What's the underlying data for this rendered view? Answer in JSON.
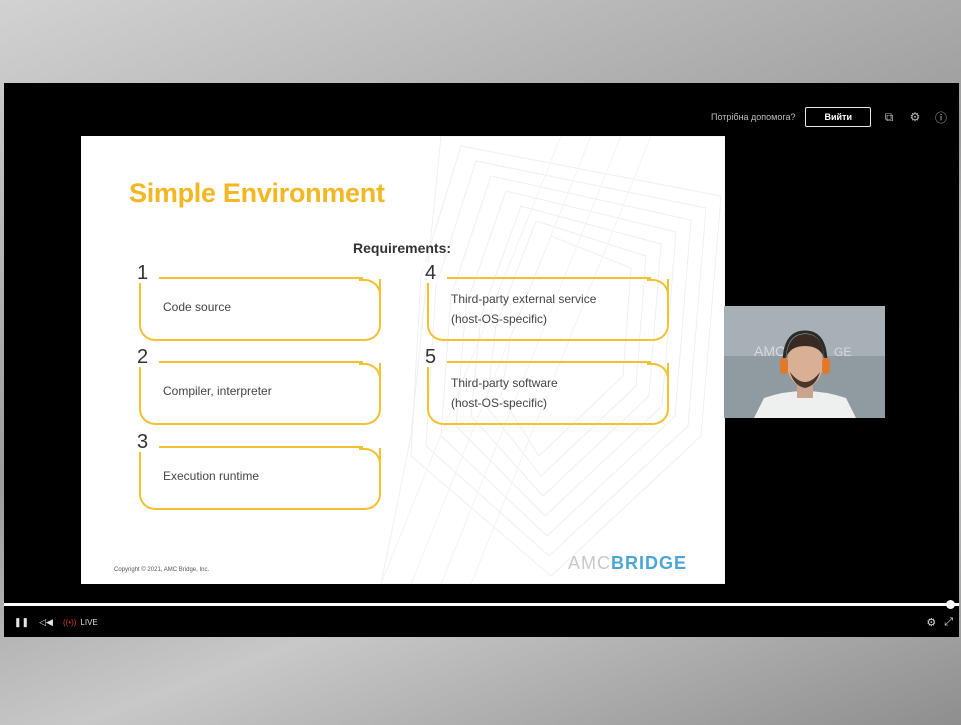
{
  "topbar": {
    "help_link": "Потрібна допомога?",
    "exit_button": "Вийти",
    "icons": [
      "copy-icon",
      "gear-icon",
      "info-icon"
    ]
  },
  "slide": {
    "title": "Simple Environment",
    "requirements_heading": "Requirements:",
    "items": [
      {
        "num": "1",
        "line1": "Code source",
        "line2": ""
      },
      {
        "num": "2",
        "line1": "Compiler, interpreter",
        "line2": ""
      },
      {
        "num": "3",
        "line1": "Execution runtime",
        "line2": ""
      },
      {
        "num": "4",
        "line1": "Third-party external service",
        "line2": "(host-OS-specific)"
      },
      {
        "num": "5",
        "line1": "Third-party software",
        "line2": "(host-OS-specific)"
      }
    ],
    "copyright": "Copyright © 2021, AMC Bridge, Inc.",
    "logo_part_a": "AMC",
    "logo_part_b": "BRIDGE"
  },
  "player": {
    "live_label": "LIVE",
    "progress": 1.0,
    "accent": "#f4b621",
    "logo_blue": "#4aa6d8",
    "live_color": "#d83232"
  }
}
